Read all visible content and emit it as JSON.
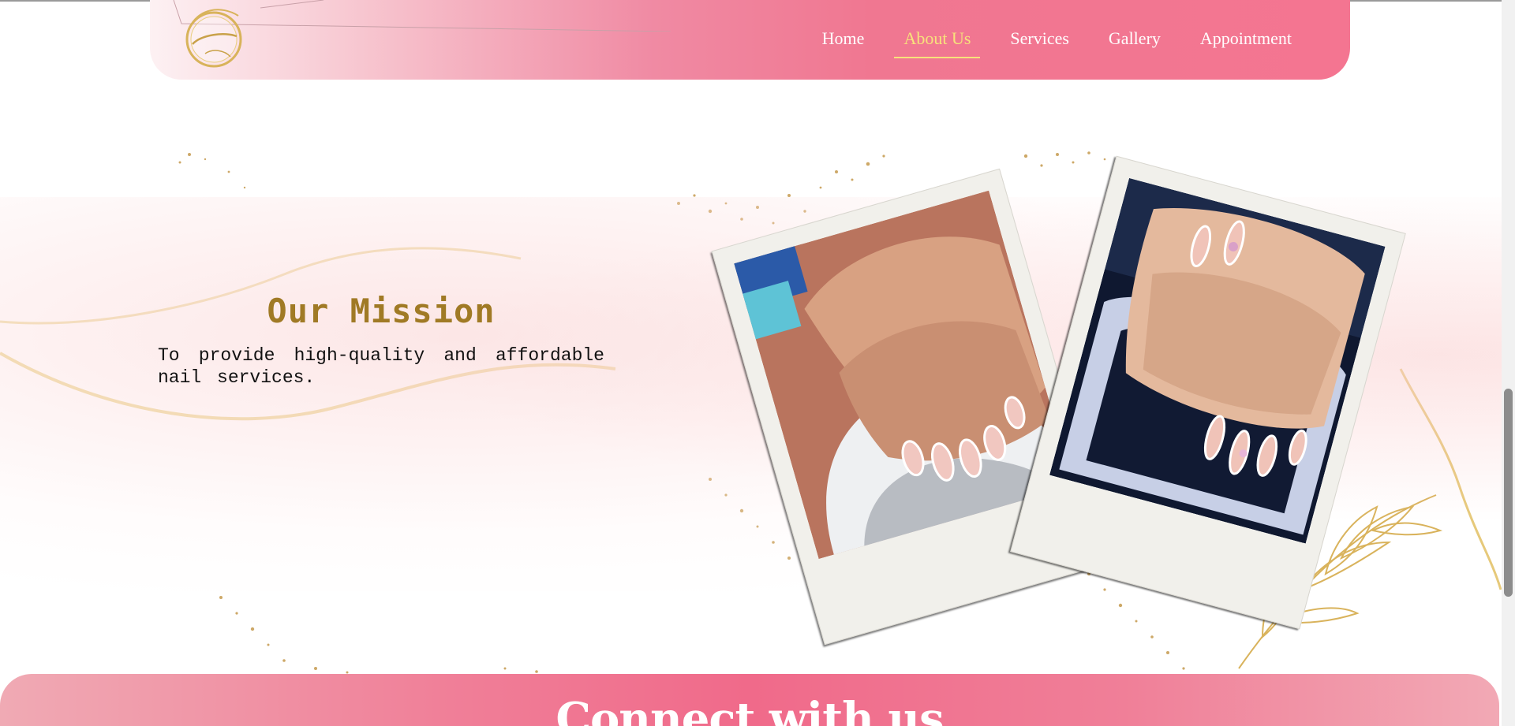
{
  "nav": {
    "logo_alt": "Cindy Nails logo",
    "links": [
      {
        "label": "Home",
        "active": false
      },
      {
        "label": "About Us",
        "active": true
      },
      {
        "label": "Services",
        "active": false
      },
      {
        "label": "Gallery",
        "active": false
      },
      {
        "label": "Appointment",
        "active": false
      }
    ],
    "active_color": "#f7e27b"
  },
  "mission": {
    "title": "Our Mission",
    "body": "To provide high-quality and affordable nail services.",
    "title_color": "#a07a25"
  },
  "gallery": {
    "photos": [
      {
        "name": "french-tip-manicure-photo"
      },
      {
        "name": "almond-nail-art-photo"
      }
    ]
  },
  "connect": {
    "title": "Connect with us"
  },
  "colors": {
    "brand_pink": "#f07791",
    "gold": "#c9a24a"
  }
}
